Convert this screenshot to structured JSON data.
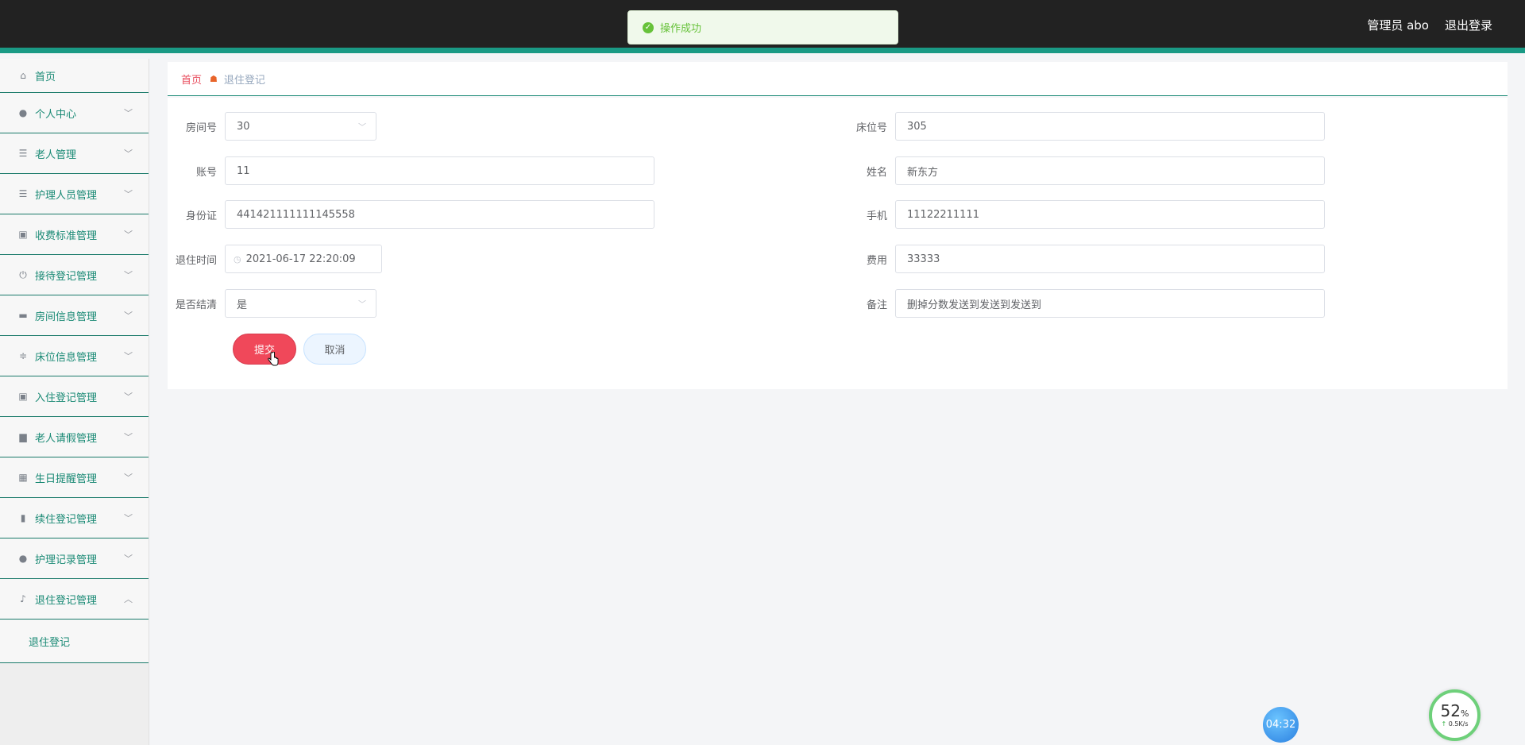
{
  "header": {
    "user": "管理员 abo",
    "logout": "退出登录"
  },
  "toast": {
    "message": "操作成功"
  },
  "sidebar": {
    "items": [
      {
        "label": "首页",
        "icon": "home-icon"
      },
      {
        "label": "个人中心",
        "icon": "user-icon"
      },
      {
        "label": "老人管理",
        "icon": "list-icon"
      },
      {
        "label": "护理人员管理",
        "icon": "list-icon"
      },
      {
        "label": "收费标准管理",
        "icon": "clipboard-icon"
      },
      {
        "label": "接待登记管理",
        "icon": "power-icon"
      },
      {
        "label": "房间信息管理",
        "icon": "monitor-icon"
      },
      {
        "label": "床位信息管理",
        "icon": "sliders-icon"
      },
      {
        "label": "入住登记管理",
        "icon": "clipboard-icon"
      },
      {
        "label": "老人请假管理",
        "icon": "printer-icon"
      },
      {
        "label": "生日提醒管理",
        "icon": "grid-icon"
      },
      {
        "label": "续住登记管理",
        "icon": "bar-chart-icon"
      },
      {
        "label": "护理记录管理",
        "icon": "user-icon"
      },
      {
        "label": "退住登记管理",
        "icon": "microphone-icon"
      }
    ],
    "submenu": "退住登记"
  },
  "breadcrumb": {
    "home": "首页",
    "current": "退住登记"
  },
  "form": {
    "room_label": "房间号",
    "room_value": "30",
    "bed_label": "床位号",
    "bed_value": "305",
    "account_label": "账号",
    "account_value": "11",
    "name_label": "姓名",
    "name_value": "新东方",
    "idcard_label": "身份证",
    "idcard_value": "441421111111145558",
    "phone_label": "手机",
    "phone_value": "11122211111",
    "checkout_label": "退住时间",
    "checkout_value": "2021-06-17 22:20:09",
    "fee_label": "费用",
    "fee_value": "33333",
    "settled_label": "是否结清",
    "settled_value": "是",
    "note_label": "备注",
    "note_value": "删掉分数发送到发送到发送到",
    "submit": "提交",
    "cancel": "取消"
  },
  "widgets": {
    "timer": "04:32",
    "gauge_percent": "52",
    "gauge_percent_sign": "%",
    "gauge_speed": "0.5K/s"
  }
}
